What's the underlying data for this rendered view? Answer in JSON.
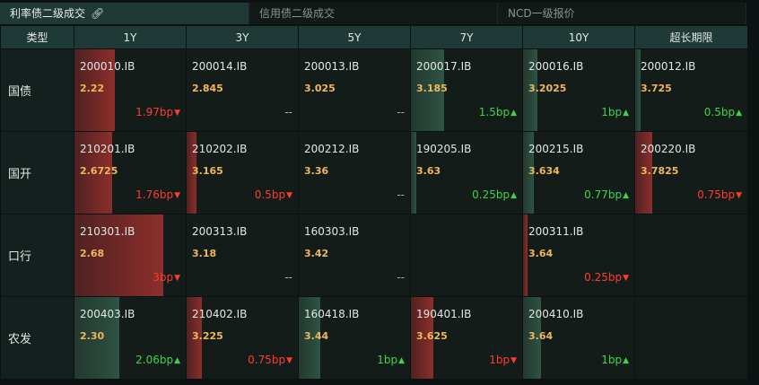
{
  "tabs": [
    {
      "label": "利率债二级成交",
      "active": true
    },
    {
      "label": "信用债二级成交",
      "active": false
    },
    {
      "label": "NCD一级报价",
      "active": false
    }
  ],
  "headers": [
    "类型",
    "1Y",
    "3Y",
    "5Y",
    "7Y",
    "10Y",
    "超长期限"
  ],
  "colors": {
    "up": "#3fd24a",
    "down": "#ff3b30",
    "price": "#f0b75a",
    "header": "#1f3a36"
  },
  "rows": [
    {
      "label": "国债",
      "cells": [
        {
          "code": "200010.IB",
          "price": "2.22",
          "change": "1.97bp",
          "dir": "down",
          "level": 0.36
        },
        {
          "code": "200014.IB",
          "price": "2.845",
          "change": "--",
          "dir": "flat",
          "level": 0
        },
        {
          "code": "200013.IB",
          "price": "3.025",
          "change": "--",
          "dir": "flat",
          "level": 0
        },
        {
          "code": "200017.IB",
          "price": "3.185",
          "change": "1.5bp",
          "dir": "up",
          "level": 0.3
        },
        {
          "code": "200016.IB",
          "price": "3.2025",
          "change": "1bp",
          "dir": "up",
          "level": 0.13
        },
        {
          "code": "200012.IB",
          "price": "3.725",
          "change": "0.5bp",
          "dir": "up",
          "level": 0.05
        }
      ]
    },
    {
      "label": "国开",
      "cells": [
        {
          "code": "210201.IB",
          "price": "2.6725",
          "change": "1.76bp",
          "dir": "down",
          "level": 0.34
        },
        {
          "code": "210202.IB",
          "price": "3.165",
          "change": "0.5bp",
          "dir": "down",
          "level": 0.09
        },
        {
          "code": "200212.IB",
          "price": "3.36",
          "change": "--",
          "dir": "flat",
          "level": 0
        },
        {
          "code": "190205.IB",
          "price": "3.63",
          "change": "0.25bp",
          "dir": "up",
          "level": 0.05
        },
        {
          "code": "200215.IB",
          "price": "3.634",
          "change": "0.77bp",
          "dir": "up",
          "level": 0.1
        },
        {
          "code": "200220.IB",
          "price": "3.7825",
          "change": "0.75bp",
          "dir": "down",
          "level": 0.15
        }
      ]
    },
    {
      "label": "口行",
      "cells": [
        {
          "code": "210301.IB",
          "price": "2.68",
          "change": "3bp",
          "dir": "down",
          "level": 0.8
        },
        {
          "code": "200313.IB",
          "price": "3.18",
          "change": "--",
          "dir": "flat",
          "level": 0
        },
        {
          "code": "160303.IB",
          "price": "3.42",
          "change": "--",
          "dir": "flat",
          "level": 0
        },
        {
          "code": "",
          "price": "",
          "change": "",
          "dir": "flat",
          "level": 0
        },
        {
          "code": "200311.IB",
          "price": "3.64",
          "change": "0.25bp",
          "dir": "down",
          "level": 0.04
        },
        {
          "code": "",
          "price": "",
          "change": "",
          "dir": "flat",
          "level": 0
        }
      ]
    },
    {
      "label": "农发",
      "cells": [
        {
          "code": "200403.IB",
          "price": "2.30",
          "change": "2.06bp",
          "dir": "up",
          "level": 0.4
        },
        {
          "code": "210402.IB",
          "price": "3.225",
          "change": "0.75bp",
          "dir": "down",
          "level": 0.14
        },
        {
          "code": "160418.IB",
          "price": "3.44",
          "change": "1bp",
          "dir": "up",
          "level": 0.19
        },
        {
          "code": "190401.IB",
          "price": "3.625",
          "change": "1bp",
          "dir": "down",
          "level": 0.2
        },
        {
          "code": "200410.IB",
          "price": "3.64",
          "change": "1bp",
          "dir": "up",
          "level": 0.16
        },
        {
          "code": "",
          "price": "",
          "change": "",
          "dir": "flat",
          "level": 0
        }
      ]
    }
  ]
}
